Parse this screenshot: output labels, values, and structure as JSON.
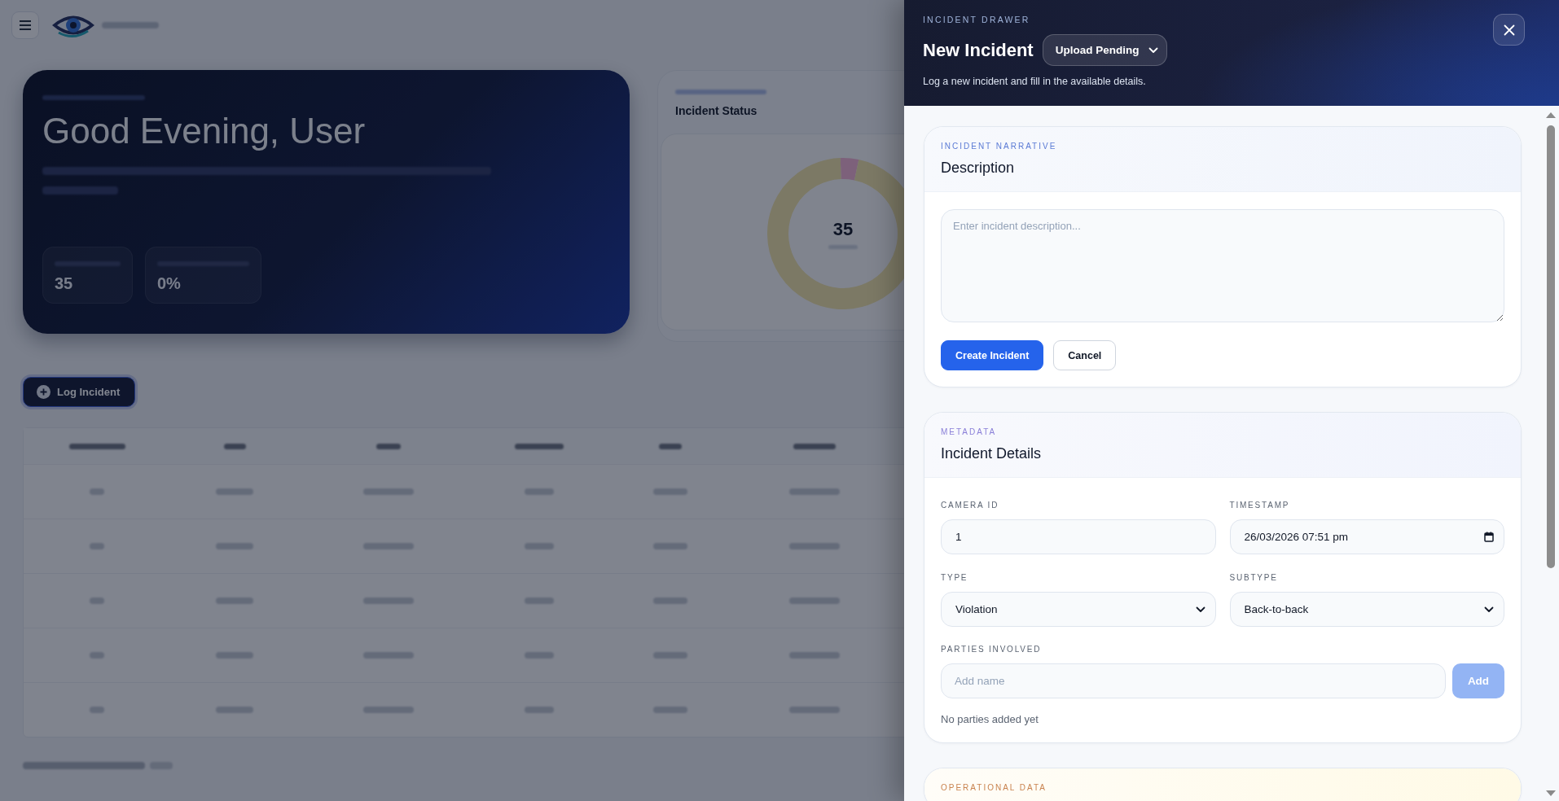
{
  "background": {
    "hero": {
      "title": "Good Evening, User",
      "stats": [
        {
          "value": "35"
        },
        {
          "value": "0%"
        }
      ]
    },
    "status_card": {
      "title": "Incident Status",
      "center_value": "35"
    },
    "log_button": {
      "label": "Log Incident"
    }
  },
  "drawer": {
    "eyebrow": "INCIDENT DRAWER",
    "title": "New Incident",
    "status_menu": {
      "label": "Upload Pending"
    },
    "subtitle": "Log a new incident and fill in the available details.",
    "sections": [
      {
        "kind": "narrative",
        "eyebrow": "INCIDENT NARRATIVE",
        "title": "Description",
        "description": {
          "placeholder": "Enter incident description..."
        },
        "buttons": [
          {
            "kind": "primary",
            "label": "Create Incident"
          },
          {
            "kind": "secondary",
            "label": "Cancel"
          }
        ]
      },
      {
        "kind": "details",
        "eyebrow": "METADATA",
        "title": "Incident Details",
        "fields": [
          {
            "kind": "text",
            "label": "CAMERA ID",
            "value": "1"
          },
          {
            "kind": "datetime",
            "label": "TIMESTAMP",
            "value": "26/03/2026 07:51 pm"
          },
          {
            "kind": "select",
            "label": "TYPE",
            "value": "Violation"
          },
          {
            "kind": "select",
            "label": "SUBTYPE",
            "value": "Back-to-back"
          }
        ],
        "parties": {
          "label": "PARTIES INVOLVED",
          "placeholder": "Add name",
          "add_button": {
            "label": "Add",
            "disabled": true
          },
          "empty_text": "No parties added yet"
        }
      },
      {
        "kind": "operational",
        "eyebrow": "OPERATIONAL DATA"
      }
    ]
  }
}
